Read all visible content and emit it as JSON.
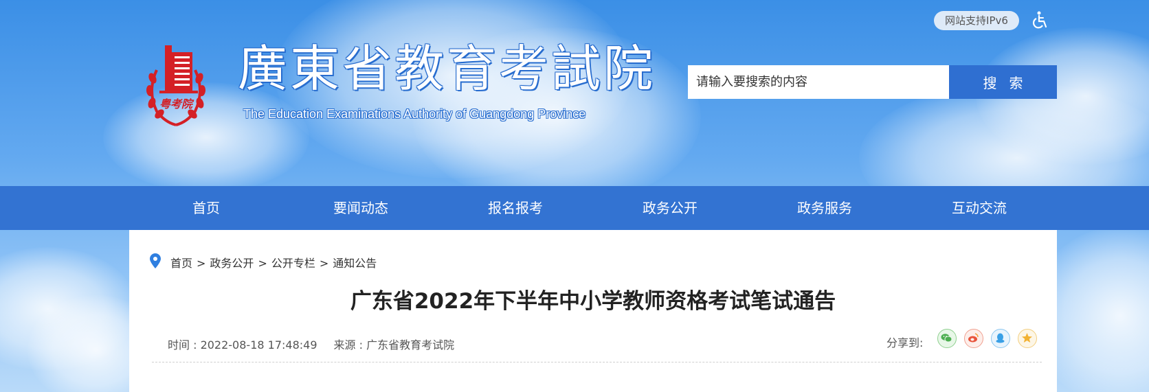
{
  "header": {
    "ipv6_badge": "网站支持IPv6",
    "title_cn": "廣東省教育考試院",
    "title_en": "The Education Examinations Authority of Guangdong Province",
    "logo_text": "粤考院",
    "accessibility_icon": "wheelchair-icon"
  },
  "search": {
    "placeholder": "请输入要搜索的内容",
    "button_label": "搜索"
  },
  "nav": {
    "items": [
      "首页",
      "要闻动态",
      "报名报考",
      "政务公开",
      "政务服务",
      "互动交流"
    ]
  },
  "breadcrumb": {
    "items": [
      "首页",
      "政务公开",
      "公开专栏",
      "通知公告"
    ],
    "separator": ">"
  },
  "article": {
    "title": "广东省2022年下半年中小学教师资格考试笔试通告",
    "time": "时间 : 2022-08-18 17:48:49",
    "source": "来源 : 广东省教育考试院"
  },
  "share": {
    "label": "分享到:",
    "icons": [
      "wechat-icon",
      "weibo-icon",
      "qq-icon",
      "qzone-icon"
    ]
  },
  "colors": {
    "nav_bg": "#3373d2",
    "search_button": "#2f6fd1",
    "logo_red": "#d42026",
    "wechat": "#4caf50",
    "weibo": "#e8543c",
    "qq": "#3aa0e6",
    "qzone": "#f2b233"
  }
}
